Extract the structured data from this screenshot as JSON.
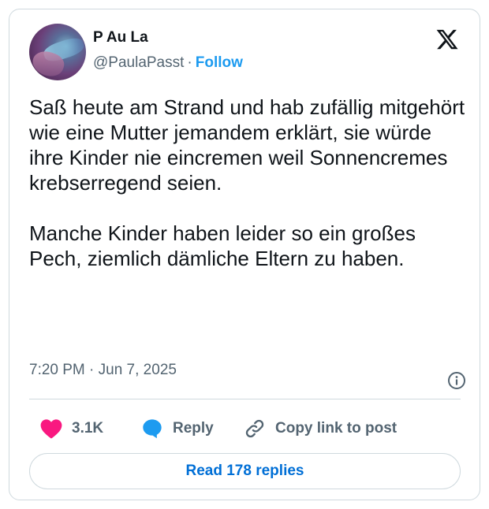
{
  "author": {
    "display_name": "P Au La",
    "handle": "@PaulaPasst",
    "separator": "·",
    "follow_label": "Follow"
  },
  "tweet": {
    "text": "Saß heute am Strand und hab zufällig mitgehört wie eine Mutter jemandem erklärt, sie würde ihre Kinder nie eincremen weil Sonnencremes krebserregend seien.\n\nManche Kinder haben leider so ein großes Pech, ziemlich dämliche Eltern zu haben.",
    "timestamp": "7:20 PM · Jun 7, 2025"
  },
  "actions": {
    "like_count": "3.1K",
    "reply_label": "Reply",
    "copy_label": "Copy link to post"
  },
  "read_replies_label": "Read 178 replies",
  "icons": {
    "logo": "x-logo-icon",
    "info": "info-icon",
    "like": "heart-icon",
    "reply": "speech-bubble-icon",
    "copy": "link-icon"
  },
  "colors": {
    "accent": "#1d9bf0",
    "like": "#f91880",
    "link_blue": "#006fd6",
    "muted": "#536471",
    "text": "#0f1419",
    "border": "#cfd9de"
  }
}
